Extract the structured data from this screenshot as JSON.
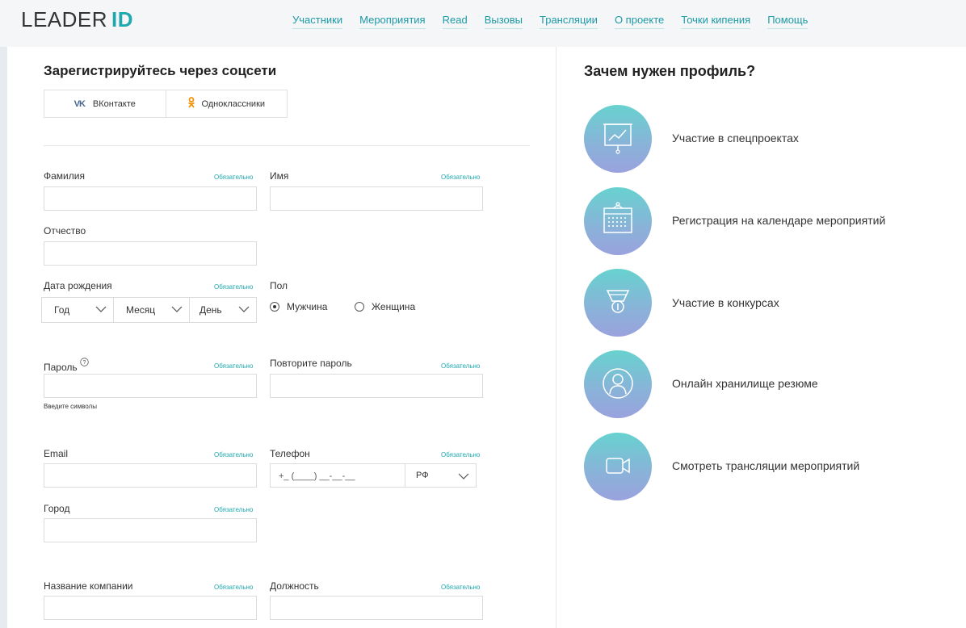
{
  "header": {
    "logo_text": "LEADER",
    "logo_id": "ID",
    "nav": [
      "Участники",
      "Мероприятия",
      "Read",
      "Вызовы",
      "Трансляции",
      "О проекте",
      "Точки кипения",
      "Помощь"
    ]
  },
  "social": {
    "title": "Зарегистрируйтесь через соцсети",
    "vk_icon": "VK",
    "vk_label": "ВКонтакте",
    "ok_label": "Одноклассники"
  },
  "form": {
    "required": "Обязательно",
    "surname_label": "Фамилия",
    "name_label": "Имя",
    "patronymic_label": "Отчество",
    "birthdate_label": "Дата рождения",
    "year": "Год",
    "month": "Месяц",
    "day": "День",
    "gender_label": "Пол",
    "male": "Мужчина",
    "female": "Женщина",
    "password_label": "Пароль",
    "password_help": "?",
    "password_hint": "Введите символы",
    "repeat_password_label": "Повторите пароль",
    "email_label": "Email",
    "phone_label": "Телефон",
    "phone_mask": "+_ (____) __-__-__",
    "phone_country": "РФ",
    "city_label": "Город",
    "company_label": "Название компании",
    "position_label": "Должность"
  },
  "why": {
    "title": "Зачем нужен профиль?",
    "features": [
      {
        "icon": "presentation-chart-icon",
        "text": "Участие в спецпроектах"
      },
      {
        "icon": "calendar-icon",
        "text": "Регистрация на календаре мероприятий"
      },
      {
        "icon": "medal-icon",
        "text": "Участие в конкурсах"
      },
      {
        "icon": "user-profile-icon",
        "text": "Онлайн хранилище резюме"
      },
      {
        "icon": "video-camera-icon",
        "text": "Смотреть трансляции мероприятий"
      }
    ]
  },
  "colors": {
    "accent": "#1fa8ae",
    "vk": "#45668e",
    "ok": "#f29100"
  }
}
